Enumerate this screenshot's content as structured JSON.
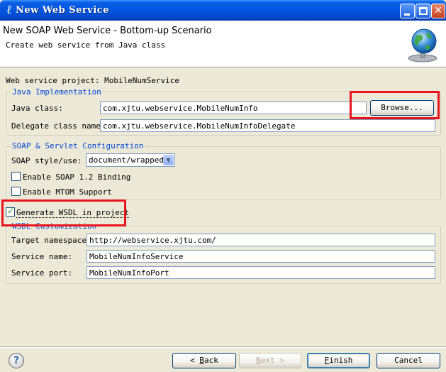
{
  "window": {
    "title": "New Web Service"
  },
  "header": {
    "title": "New SOAP Web Service - Bottom-up Scenario",
    "subtitle": "Create web service from Java class"
  },
  "project": {
    "label": "Web service project: MobileNumService"
  },
  "java_impl": {
    "legend": "Java Implementation",
    "java_class_label": "Java class:",
    "java_class_value": "com.xjtu.webservice.MobileNumInfo",
    "browse_label": "Browse...",
    "delegate_label": "Delegate class name:",
    "delegate_value": "com.xjtu.webservice.MobileNumInfoDelegate"
  },
  "soap": {
    "legend": "SOAP & Servlet Configuration",
    "style_label": "SOAP style/use:",
    "style_value": "document/wrapped",
    "enable_soap12_label": "Enable SOAP 1.2 Binding",
    "enable_soap12_checked": false,
    "enable_mtom_label": "Enable MTOM Support",
    "enable_mtom_checked": false
  },
  "wsdl": {
    "generate_label": "Generate WSDL in project",
    "generate_checked": true,
    "legend": "WSDL Customization",
    "namespace_label": "Target namespace:",
    "namespace_value": "http://webservice.xjtu.com/",
    "service_name_label": "Service name:",
    "service_name_value": "MobileNumInfoService",
    "service_port_label": "Service port:",
    "service_port_value": "MobileNumInfoPort"
  },
  "footer": {
    "help_glyph": "?",
    "back": {
      "arrow": "<",
      "key": "B",
      "rest": "ack"
    },
    "next": {
      "key": "N",
      "rest": "ext",
      "arrow": ">"
    },
    "finish": {
      "key": "F",
      "rest": "inish"
    },
    "cancel_label": "Cancel"
  },
  "icons": {
    "app": "eclipse-icon",
    "header": "globe-webservice-icon",
    "help": "help-icon"
  },
  "colors": {
    "titlebar": "#0456e0",
    "legend_text": "#0046d5",
    "highlight_box": "#e8141c",
    "dialog_bg": "#ece9d8"
  }
}
